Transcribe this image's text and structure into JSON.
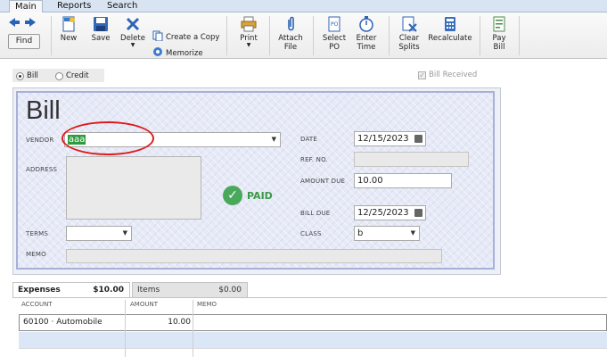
{
  "menu": {
    "tabs": [
      {
        "label": "Main",
        "active": true
      },
      {
        "label": "Reports"
      },
      {
        "label": "Search"
      }
    ]
  },
  "toolbar": {
    "find_label": "Find",
    "new_label": "New",
    "save_label": "Save",
    "delete_label": "Delete",
    "create_copy_label": "Create a Copy",
    "memorize_label": "Memorize",
    "print_label": "Print",
    "attach_label_1": "Attach",
    "attach_label_2": "File",
    "select_po_label_1": "Select",
    "select_po_label_2": "PO",
    "enter_time_label_1": "Enter",
    "enter_time_label_2": "Time",
    "clear_splits_label_1": "Clear",
    "clear_splits_label_2": "Splits",
    "recalculate_label": "Recalculate",
    "pay_bill_label_1": "Pay",
    "pay_bill_label_2": "Bill"
  },
  "type": {
    "bill_label": "Bill",
    "credit_label": "Credit",
    "selected": "Bill",
    "bill_received_label": "Bill Received",
    "bill_received_checked": true
  },
  "form": {
    "title": "Bill",
    "vendor_label": "VENDOR",
    "vendor_value": "aaa",
    "address_label": "ADDRESS",
    "address_value": "",
    "terms_label": "TERMS",
    "terms_value": "",
    "memo_label": "MEMO",
    "memo_value": "",
    "date_label": "DATE",
    "date_value": "12/15/2023",
    "ref_label": "REF. NO.",
    "ref_value": "",
    "amount_due_label": "AMOUNT DUE",
    "amount_due_value": "10.00",
    "bill_due_label": "BILL DUE",
    "bill_due_value": "12/25/2023",
    "class_label": "CLASS",
    "class_value": "b",
    "paid_stamp": "PAID"
  },
  "tabs": {
    "expenses_label": "Expenses",
    "expenses_amount": "$10.00",
    "items_label": "Items",
    "items_amount": "$0.00"
  },
  "grid": {
    "headers": [
      "ACCOUNT",
      "AMOUNT",
      "MEMO"
    ],
    "rows": [
      {
        "account": "60100 · Automobile",
        "amount": "10.00",
        "memo": ""
      }
    ]
  },
  "colors": {
    "accent_green": "#4aa85a",
    "annotation_red": "#e01a1a",
    "panel_border": "#a8b0d8"
  }
}
